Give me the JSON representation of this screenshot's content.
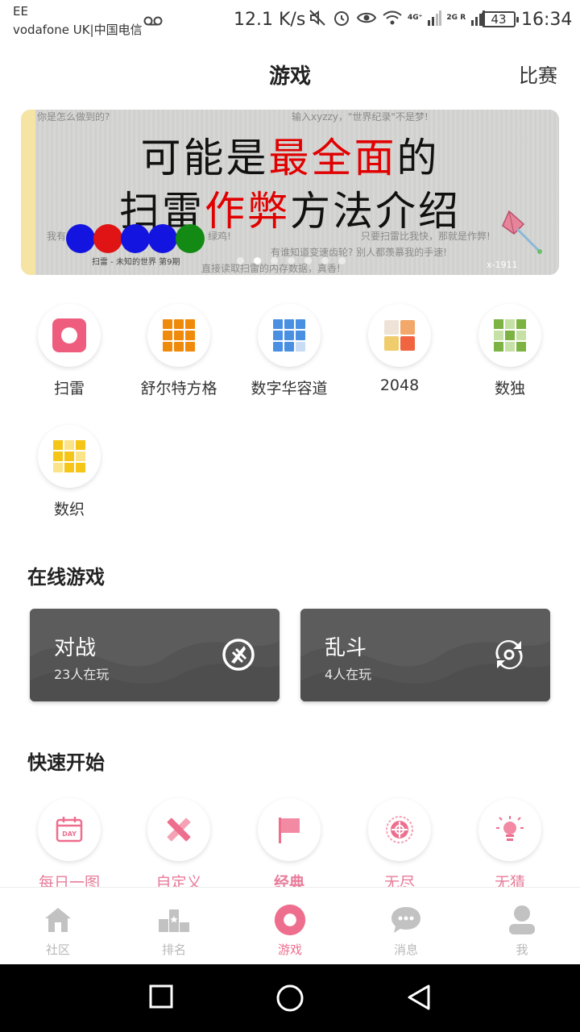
{
  "status_bar": {
    "carrier_line1": "EE",
    "carrier_line2": "vodafone UK|中国电信",
    "net_speed": "12.1 K/s",
    "sim1_label": "4G⁺",
    "sim2_label": "2G R",
    "battery": "43",
    "time": "16:34"
  },
  "header": {
    "title": "游戏",
    "right_action": "比赛"
  },
  "banner": {
    "line1_a": "可能是",
    "line1_b": "最全面",
    "line1_c": "的",
    "line2_a": "扫雷",
    "line2_b": "作弊",
    "line2_c": "方法介绍",
    "sub1": "你是怎么做到的?",
    "sub2": "输入xyzzy，\"世界纪录\"不是梦!",
    "sub3": "我有",
    "sub4": "绿鸡!",
    "sub5": "只要扫雷比我快，那就是作弊!",
    "sub6": "有谁知道变速齿轮? 别人都羡慕我的手速!",
    "sub7": "直接读取扫雷的内存数据，真香!",
    "caption": "扫雷 - 未知的世界  第9期",
    "mark": "x-1911",
    "dot_count": 7,
    "active_dot": 1
  },
  "games": [
    {
      "label": "扫雷",
      "icon": "minesweeper-icon"
    },
    {
      "label": "舒尔特方格",
      "icon": "schulte-grid-icon"
    },
    {
      "label": "数字华容道",
      "icon": "number-puzzle-icon"
    },
    {
      "label": "2048",
      "icon": "2048-icon"
    },
    {
      "label": "数独",
      "icon": "sudoku-icon"
    },
    {
      "label": "数织",
      "icon": "nonogram-icon"
    }
  ],
  "online": {
    "title": "在线游戏",
    "cards": [
      {
        "title": "对战",
        "players": "23人在玩",
        "icon": "battle-icon"
      },
      {
        "title": "乱斗",
        "players": "4人在玩",
        "icon": "brawl-icon"
      }
    ]
  },
  "quick_start": {
    "title": "快速开始",
    "items": [
      {
        "label": "每日一图",
        "icon": "calendar-day-icon",
        "day_text": "DAY"
      },
      {
        "label": "自定义",
        "icon": "ruler-pencil-icon"
      },
      {
        "label": "经典",
        "icon": "flag-icon"
      },
      {
        "label": "无尽",
        "icon": "target-icon"
      },
      {
        "label": "无猜",
        "icon": "lightbulb-icon"
      }
    ]
  },
  "bottom_nav": [
    {
      "label": "社区",
      "icon": "home-icon"
    },
    {
      "label": "排名",
      "icon": "podium-icon"
    },
    {
      "label": "游戏",
      "icon": "game-icon",
      "active": true
    },
    {
      "label": "消息",
      "icon": "chat-icon"
    },
    {
      "label": "我",
      "icon": "user-icon"
    }
  ],
  "colors": {
    "accent": "#ee6e8e",
    "card_bg": "#545454",
    "banner_red": "#e00000"
  }
}
